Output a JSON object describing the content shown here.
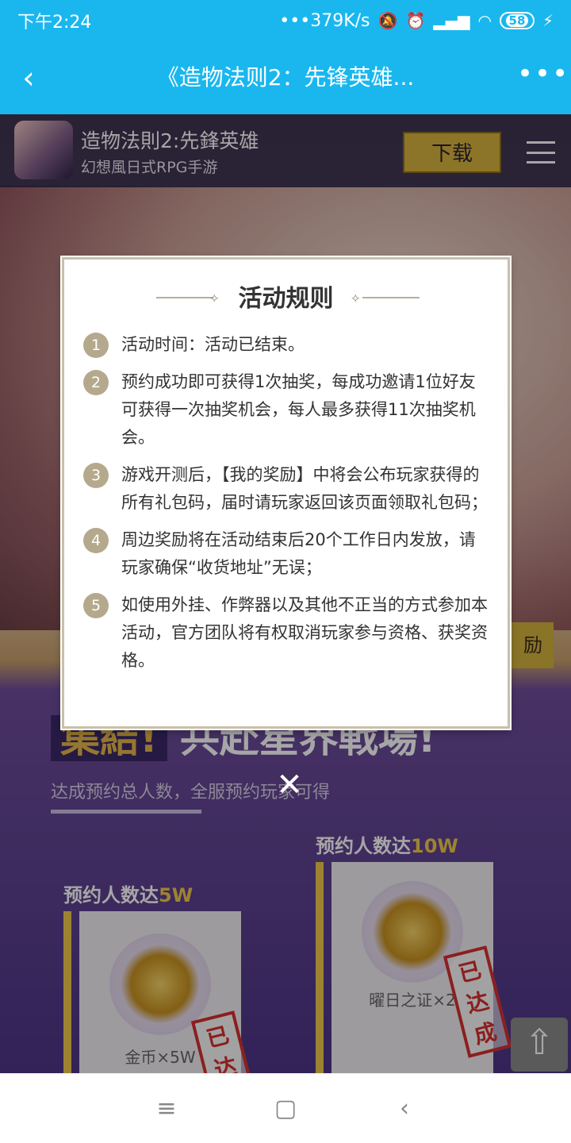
{
  "status_bar": {
    "time": "下午2:24",
    "network_speed": "•••379K/s",
    "battery": "58"
  },
  "nav": {
    "title": "《造物法则2：先锋英雄..."
  },
  "app": {
    "name": "造物法則2:先鋒英雄",
    "subtitle": "幻想風日式RPG手游",
    "download_label": "下载"
  },
  "dialog": {
    "title": "活动规则",
    "rules": [
      {
        "num": "1",
        "text": "活动时间：活动已结束。"
      },
      {
        "num": "2",
        "text": "预约成功即可获得1次抽奖，每成功邀请1位好友可获得一次抽奖机会，每人最多获得11次抽奖机会。"
      },
      {
        "num": "3",
        "text": "游戏开测后，【我的奖励】中将会公布玩家获得的所有礼包码，届时请玩家返回该页面领取礼包码；"
      },
      {
        "num": "4",
        "text": "周边奖励将在活动结束后20个工作日内发放，请玩家确保“收货地址”无误；"
      },
      {
        "num": "5",
        "text": "如使用外挂、作弊器以及其他不正当的方式参加本活动，官方团队将有权取消玩家参与资格、获奖资格。"
      }
    ]
  },
  "promo": {
    "tag": "集結!",
    "title": "共赴星界戦場!",
    "subtitle": "达成预约总人数，全服预约玩家可得",
    "side_button": "励",
    "tiers": [
      {
        "head_prefix": "预约人数达",
        "head_value": "5W",
        "reward": "金币×5W",
        "stamp": "已达成"
      },
      {
        "head_prefix": "预约人数达",
        "head_value": "10W",
        "reward": "曜日之证×2",
        "stamp": "已达成"
      }
    ]
  }
}
